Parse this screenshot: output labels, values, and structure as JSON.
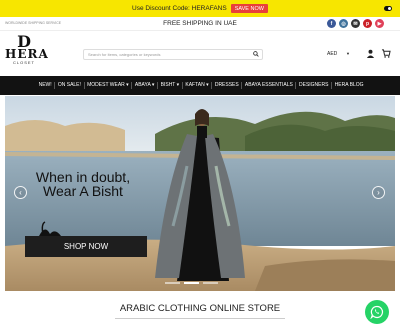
{
  "promo": {
    "text": "Use Discount Code: HERAFANS",
    "button": "SAVE NOW"
  },
  "topbar": {
    "left_text": "WORLDWIDE SHIPPING SERVICE",
    "center_text": "FREE SHIPPING IN UAE",
    "socials": [
      {
        "icon": "facebook-icon",
        "glyph": "f",
        "color": "#3b5998"
      },
      {
        "icon": "instagram-icon",
        "glyph": "◎",
        "color": "#3f729b"
      },
      {
        "icon": "email-icon",
        "glyph": "✉",
        "color": "#333333"
      },
      {
        "icon": "pinterest-icon",
        "glyph": "p",
        "color": "#cb2027"
      },
      {
        "icon": "youtube-icon",
        "glyph": "▶",
        "color": "#e0415a"
      }
    ]
  },
  "header": {
    "logo": {
      "mark": "D",
      "name": "HERA",
      "sub": "CLOSET"
    },
    "search_placeholder": "Search for items, categories or keywords",
    "currency": "AED",
    "caret": "▼"
  },
  "nav": {
    "items": [
      "NEW!",
      "ON SALE!",
      "MODEST WEAR ▾",
      "ABAYA ▾",
      "BISHT ▾",
      "KAFTAN ▾",
      "DRESSES",
      "ABAYA ESSENTIALS",
      "DESIGNERS",
      "HERA BLOG"
    ]
  },
  "hero": {
    "title": "When in doubt, Wear A Bisht",
    "button": "SHOP NOW",
    "prev": "‹",
    "next": "›",
    "slides": 3,
    "active_slide": 1
  },
  "section": {
    "title": "ARABIC CLOTHING ONLINE STORE"
  }
}
